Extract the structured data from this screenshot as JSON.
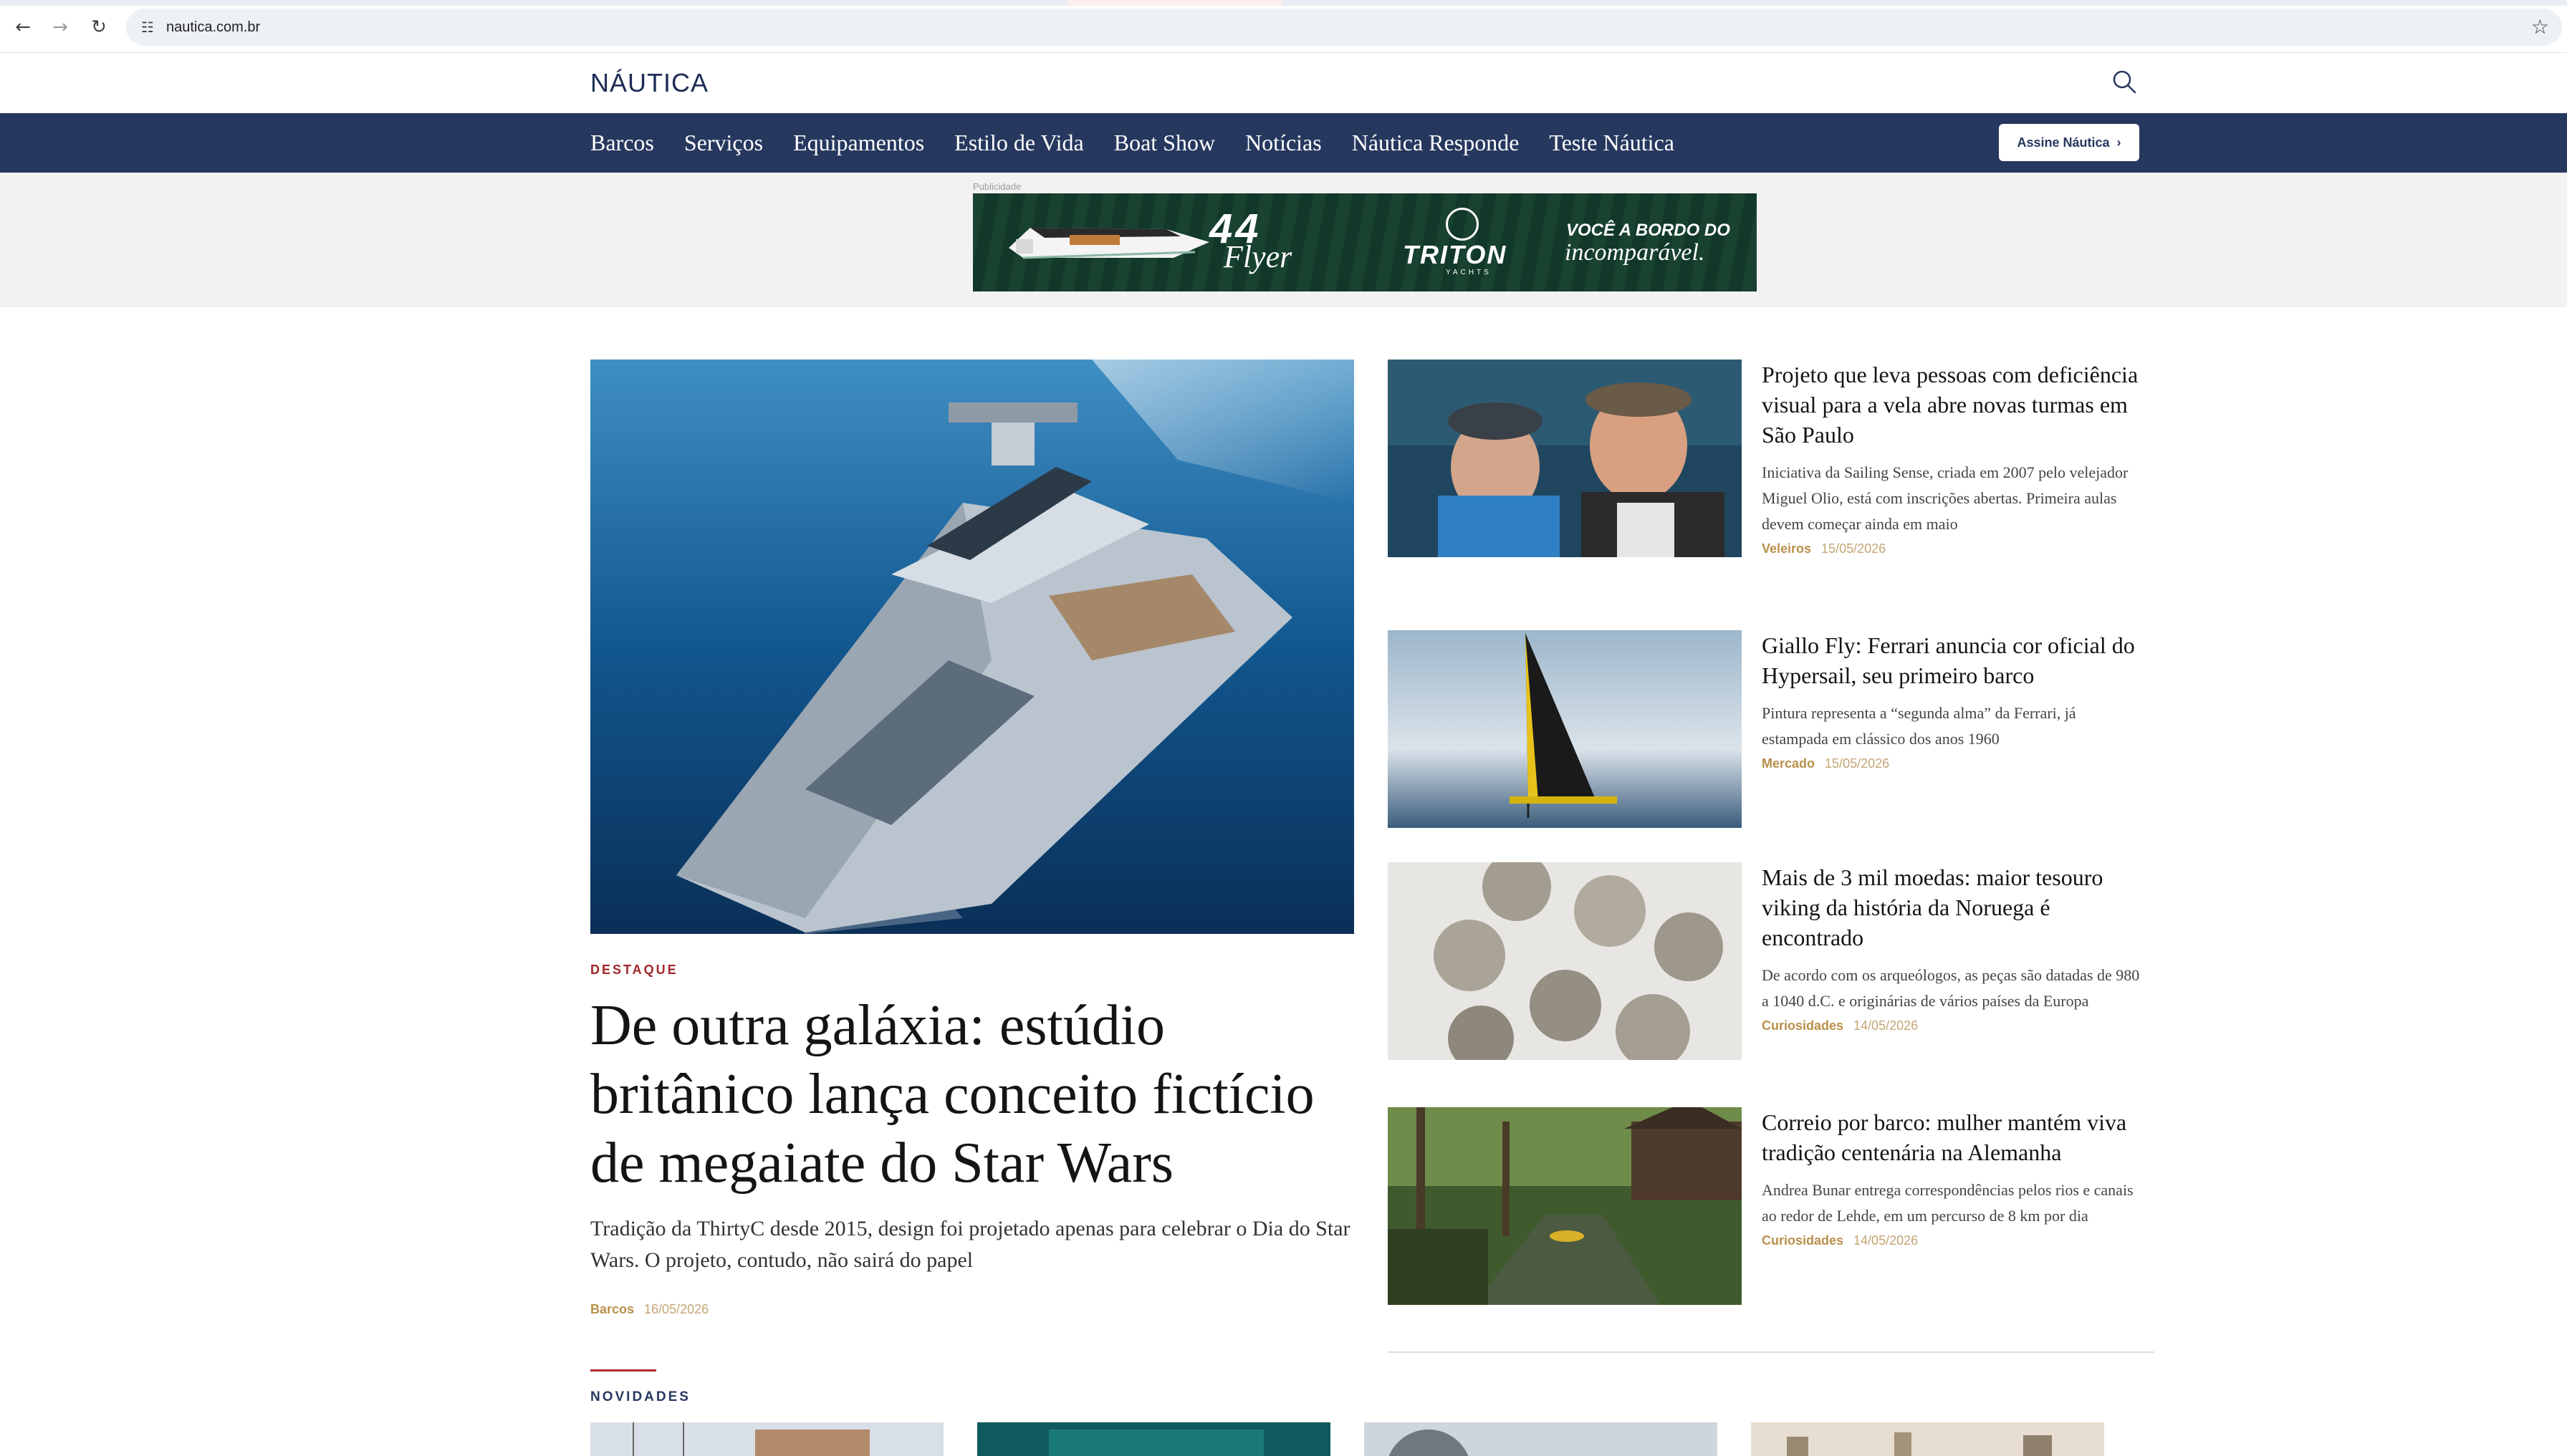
{
  "browser": {
    "url": "nautica.com.br",
    "back_icon": "←",
    "forward_icon": "→",
    "reload_icon": "↻",
    "site_info_icon": "☷",
    "bookmark_icon": "☆"
  },
  "header": {
    "logo": "NÁUTICA",
    "nav": [
      "Barcos",
      "Serviços",
      "Equipamentos",
      "Estilo de Vida",
      "Boat Show",
      "Notícias",
      "Náutica Responde",
      "Teste Náutica"
    ],
    "subscribe_label": "Assine Náutica",
    "subscribe_chevron": "›"
  },
  "ad": {
    "label": "Publicidade",
    "model_number": "44",
    "model_name": "Flyer",
    "brand": "TRITON",
    "brand_sub": "YACHTS",
    "tagline_1": "VOCÊ A BORDO DO",
    "tagline_2": "incomparável."
  },
  "featured": {
    "kicker": "DESTAQUE",
    "title": "De outra galáxia: estúdio britânico lança conceito fictício de megaiate do Star Wars",
    "dek": "Tradição da ThirtyC desde 2015, design foi projetado apenas para celebrar o Dia do Star Wars. O projeto, contudo, não sairá do papel",
    "category": "Barcos",
    "date": "16/05/2026"
  },
  "side_articles": [
    {
      "title": "Projeto que leva pessoas com deficiência visual para a vela abre novas turmas em São Paulo",
      "dek": "Iniciativa da Sailing Sense, criada em 2007 pelo velejador Miguel Olio, está com inscrições abertas. Primeira aulas devem começar ainda em maio",
      "category": "Veleiros",
      "date": "15/05/2026"
    },
    {
      "title": "Giallo Fly: Ferrari anuncia cor oficial do Hypersail, seu primeiro barco",
      "dek": "Pintura representa a “segunda alma” da Ferrari, já estampada em clássico dos anos 1960",
      "category": "Mercado",
      "date": "15/05/2026"
    },
    {
      "title": "Mais de 3 mil moedas: maior tesouro viking da história da Noruega é encontrado",
      "dek": "De acordo com os arqueólogos, as peças são datadas de 980 a 1040 d.C. e originárias de vários países da Europa",
      "category": "Curiosidades",
      "date": "14/05/2026"
    },
    {
      "title": "Correio por barco: mulher mantém viva tradição centenária na Alemanha",
      "dek": "Andrea Bunar entrega correspondências pelos rios e canais ao redor de Lehde, em um percurso de 8 km por dia",
      "category": "Curiosidades",
      "date": "14/05/2026"
    }
  ],
  "novidades": {
    "label": "NOVIDADES"
  },
  "colors": {
    "navy": "#27385f",
    "accent_red": "#a0262b",
    "meta_gold": "#b8904a"
  }
}
